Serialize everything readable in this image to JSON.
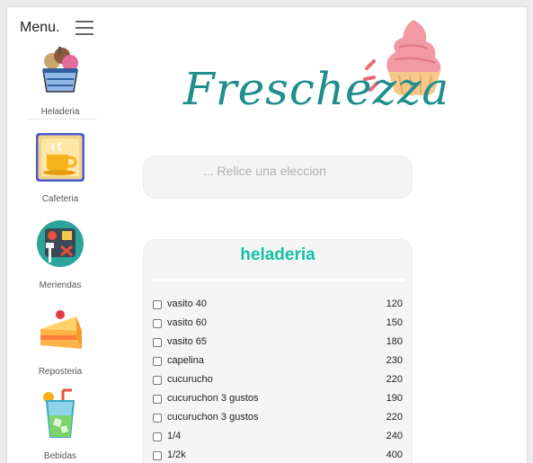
{
  "sidebar": {
    "menu_label": "Menu.",
    "items": [
      {
        "label": "Heladeria",
        "icon": "ice-cream-cup-icon"
      },
      {
        "label": "Cafeteria",
        "icon": "coffee-cup-icon"
      },
      {
        "label": "Meriendas",
        "icon": "snack-plate-icon"
      },
      {
        "label": "Reposteria",
        "icon": "cake-slice-icon"
      },
      {
        "label": "Bebidas",
        "icon": "drink-glass-icon"
      }
    ]
  },
  "logo": {
    "text": "Freschezza",
    "icon": "ice-cream-cupcake-icon"
  },
  "search": {
    "placeholder": "... Relice una eleccion"
  },
  "panel": {
    "title": "heladeria",
    "items": [
      {
        "name": "vasito 40",
        "price": "120"
      },
      {
        "name": "vasito 60",
        "price": "150"
      },
      {
        "name": "vasito 65",
        "price": "180"
      },
      {
        "name": "capelina",
        "price": "230"
      },
      {
        "name": "cucurucho",
        "price": "220"
      },
      {
        "name": "cucuruchon 3 gustos",
        "price": "190"
      },
      {
        "name": "cucuruchon 3 gustos",
        "price": "220"
      },
      {
        "name": "1/4",
        "price": "240"
      },
      {
        "name": "1/2k",
        "price": "400"
      }
    ]
  },
  "colors": {
    "brand_teal": "#1f8e8c",
    "title_teal": "#16c0a4"
  }
}
